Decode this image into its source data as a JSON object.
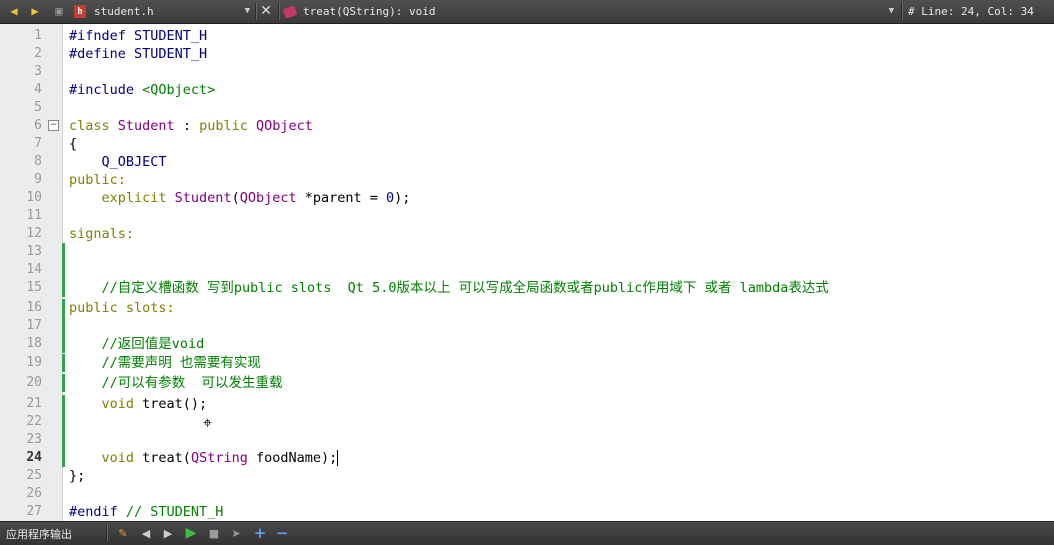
{
  "toolbar": {
    "file_name": "student.h",
    "file_icon_letter": "h",
    "symbol": "treat(QString): void",
    "position_label": "#  Line: 24, Col: 34"
  },
  "editor": {
    "current_line": 24,
    "line_numbers": [
      "1",
      "2",
      "3",
      "4",
      "5",
      "6",
      "7",
      "8",
      "9",
      "10",
      "11",
      "12",
      "13",
      "14",
      "15",
      "16",
      "17",
      "18",
      "19",
      "20",
      "21",
      "22",
      "23",
      "24",
      "25",
      "26",
      "27"
    ],
    "lines": {
      "l1_a": "#ifndef STUDENT_H",
      "l2_a": "#define STUDENT_H",
      "l4_a": "#include ",
      "l4_b": "<QObject>",
      "l6_a": "class ",
      "l6_b": "Student",
      "l6_c": " : ",
      "l6_d": "public ",
      "l6_e": "QObject",
      "l7_a": "{",
      "l8_a": "    Q_OBJECT",
      "l9_a": "public:",
      "l10_a": "    explicit ",
      "l10_b": "Student",
      "l10_c": "(",
      "l10_d": "QObject",
      "l10_e": " *parent = ",
      "l10_f": "0",
      "l10_g": ");",
      "l12_a": "signals:",
      "l15_a": "    //自定义槽函数 写到public slots  Qt 5.0版本以上 可以写成全局函数或者public作用域下 或者 lambda表达式",
      "l16_a": "public slots:",
      "l18_a": "    //返回值是void",
      "l19_a": "    //需要声明 也需要有实现",
      "l20_a": "    //可以有参数  可以发生重载",
      "l21_a": "    void ",
      "l21_b": "treat",
      "l21_c": "();",
      "l24_a": "    void ",
      "l24_b": "treat",
      "l24_c": "(",
      "l24_d": "QString",
      "l24_e": " foodName",
      "l24_f": ");",
      "l25_a": "};",
      "l27_a": "#endif ",
      "l27_b": "// STUDENT_H"
    }
  },
  "bottombar": {
    "output_tab_label": "应用程序输出"
  },
  "colors": {
    "keyword": "#808000",
    "type": "#800080",
    "preprocessor": "#000080",
    "comment": "#008000",
    "changed_line_marker": "#2ea44f"
  }
}
